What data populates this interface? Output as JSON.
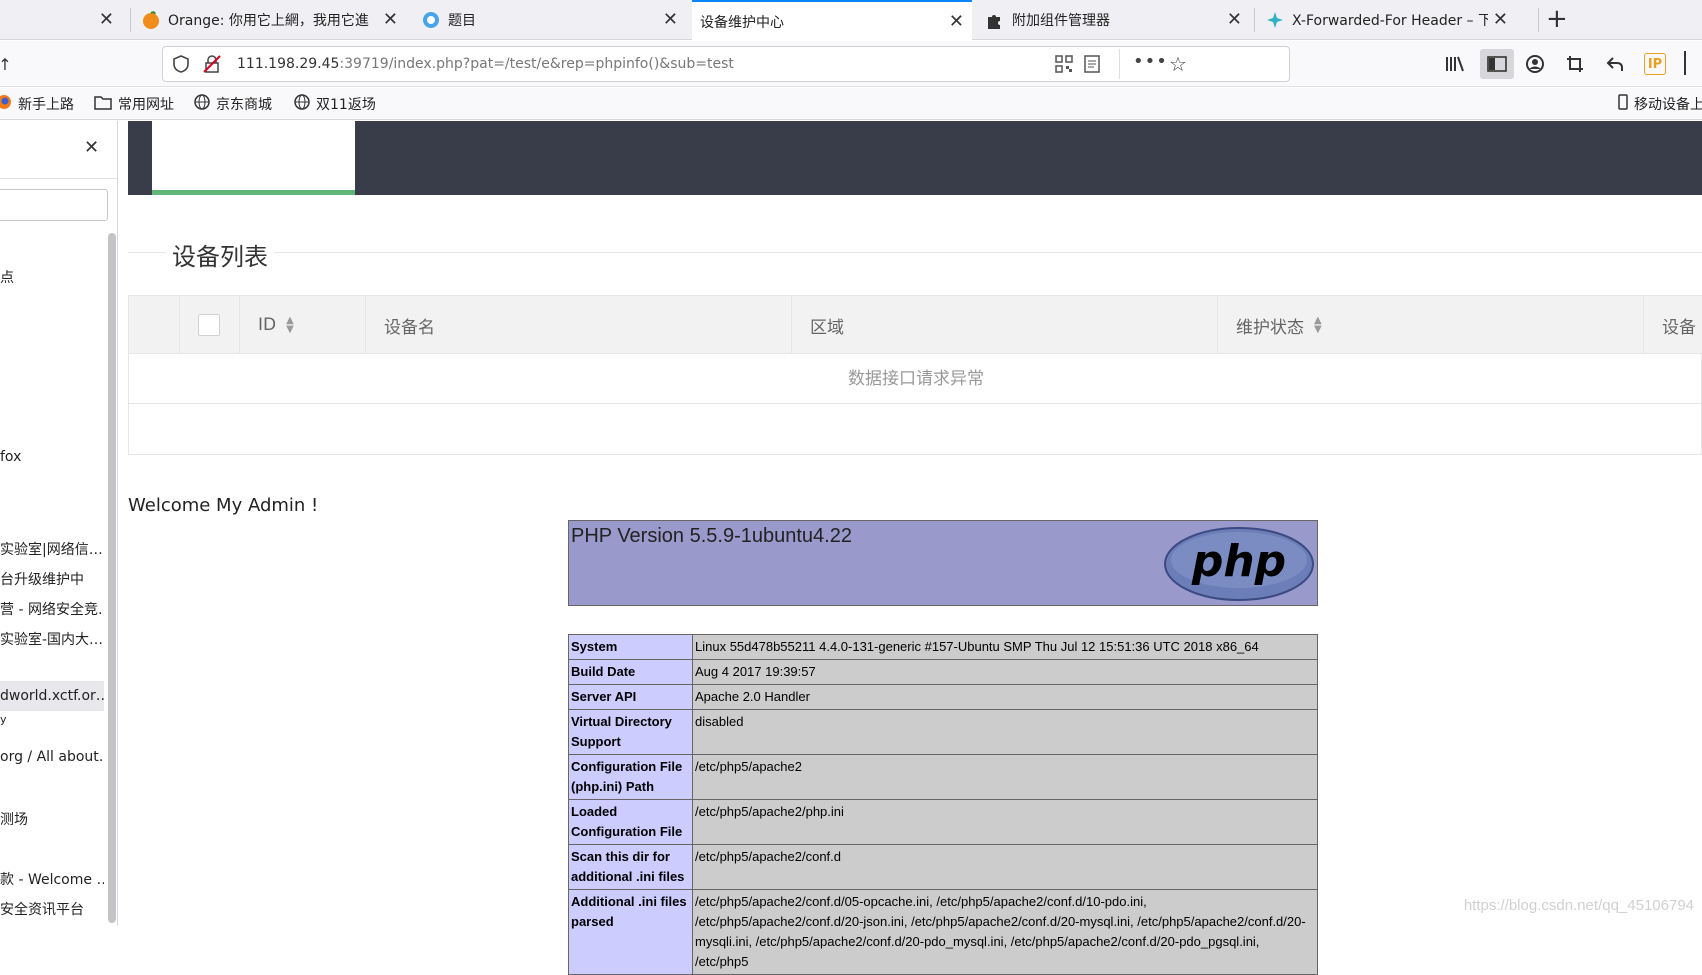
{
  "tabs": [
    {
      "label": "",
      "icon": "blank-tab-icon"
    },
    {
      "label": "Orange: 你用它上網，我用它進",
      "icon": "orange-icon"
    },
    {
      "label": "题目",
      "icon": "globe-icon"
    },
    {
      "label": "设备维护中心",
      "icon": "none",
      "active": true
    },
    {
      "label": "附加组件管理器",
      "icon": "puzzle-icon"
    },
    {
      "label": "X-Forwarded-For Header – 下载",
      "icon": "addon-icon"
    }
  ],
  "nav": {
    "url_host": "111.198.29.45",
    "url_rest": ":39719/index.php?pat=/test/e&rep=phpinfo()&sub=test"
  },
  "bookmarks": [
    "新手上路",
    "常用网址",
    "京东商城",
    "双11返场",
    "移动设备上"
  ],
  "sidebar": {
    "items": [
      "点",
      "fox",
      "实验室|网络信…",
      "台升级维护中",
      "营 - 网络安全竞…",
      "实验室-国内大…",
      "dworld.xctf.or…",
      "y",
      "org / All about…",
      "测场",
      "款 - Welcome …",
      "安全资讯平台"
    ]
  },
  "page": {
    "legend": "设备列表",
    "columns": [
      "ID",
      "设备名",
      "区域",
      "维护状态",
      "设备"
    ],
    "empty_text": "数据接口请求异常",
    "welcome": "Welcome My Admin !"
  },
  "phpinfo": {
    "version": "PHP Version 5.5.9-1ubuntu4.22",
    "logo_text": "php",
    "rows": [
      {
        "k": "System",
        "v": "Linux 55d478b55211 4.4.0-131-generic #157-Ubuntu SMP Thu Jul 12 15:51:36 UTC 2018 x86_64"
      },
      {
        "k": "Build Date",
        "v": "Aug 4 2017 19:39:57"
      },
      {
        "k": "Server API",
        "v": "Apache 2.0 Handler"
      },
      {
        "k": "Virtual Directory Support",
        "v": "disabled"
      },
      {
        "k": "Configuration File (php.ini) Path",
        "v": "/etc/php5/apache2"
      },
      {
        "k": "Loaded Configuration File",
        "v": "/etc/php5/apache2/php.ini"
      },
      {
        "k": "Scan this dir for additional .ini files",
        "v": "/etc/php5/apache2/conf.d"
      },
      {
        "k": "Additional .ini files parsed",
        "v": "/etc/php5/apache2/conf.d/05-opcache.ini, /etc/php5/apache2/conf.d/10-pdo.ini, /etc/php5/apache2/conf.d/20-json.ini, /etc/php5/apache2/conf.d/20-mysql.ini, /etc/php5/apache2/conf.d/20-mysqli.ini, /etc/php5/apache2/conf.d/20-pdo_mysql.ini, /etc/php5/apache2/conf.d/20-pdo_pgsql.ini, /etc/php5"
      }
    ]
  },
  "watermark": "https://blog.csdn.net/qq_45106794"
}
